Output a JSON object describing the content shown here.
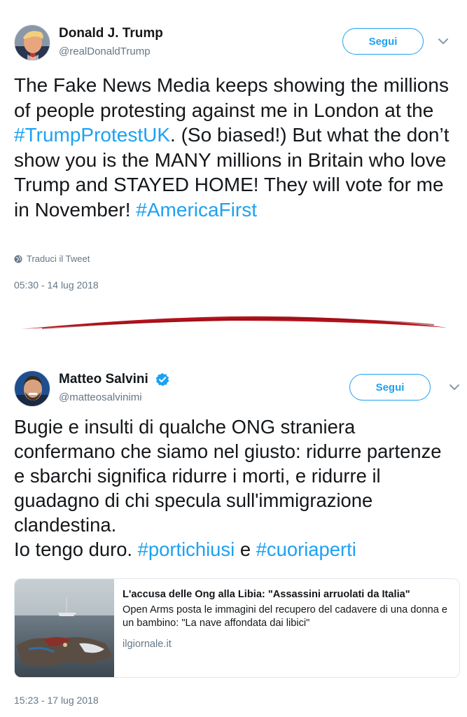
{
  "tweets": [
    {
      "author": {
        "name": "Donald J. Trump",
        "handle": "@realDonaldTrump",
        "verified": false
      },
      "follow_label": "Segui",
      "menu_icon": "chevron-down-icon",
      "text_parts": [
        "The Fake News Media keeps showing the millions of people protesting against me in London at the ",
        "#TrumpProtestUK",
        ". (So biased!) But what the don’t show you is the MANY millions in Britain who love Trump and STAYED HOME! They will vote for me in November! ",
        "#AmericaFirst"
      ],
      "translate_label": "Traduci il Tweet",
      "translate_icon": "globe-icon",
      "timestamp": "05:30 - 14 lug 2018"
    },
    {
      "author": {
        "name": "Matteo Salvini",
        "handle": "@matteosalvinimi",
        "verified": true
      },
      "follow_label": "Segui",
      "menu_icon": "chevron-down-icon",
      "text_parts": [
        "Bugie e insulti di qualche ONG straniera confermano che siamo nel giusto: ridurre partenze e sbarchi significa ridurre i morti, e ridurre il guadagno di chi specula sull'immigrazione clandestina.",
        "Io tengo duro. ",
        "#portichiusi",
        " e ",
        "#cuoriaperti"
      ],
      "card": {
        "title": "L'accusa delle Ong alla Libia: \"Assassini arruolati da Italia\"",
        "description": "Open Arms posta le immagini del recupero del cadavere di una donna e un bambino: \"La nave affondata dai libici\"",
        "domain": "ilgiornale.it"
      },
      "timestamp": "15:23 - 17 lug 2018"
    }
  ],
  "colors": {
    "accent": "#1da1f2",
    "divider": "#b5121b",
    "muted": "#657786",
    "text": "#14171a"
  }
}
